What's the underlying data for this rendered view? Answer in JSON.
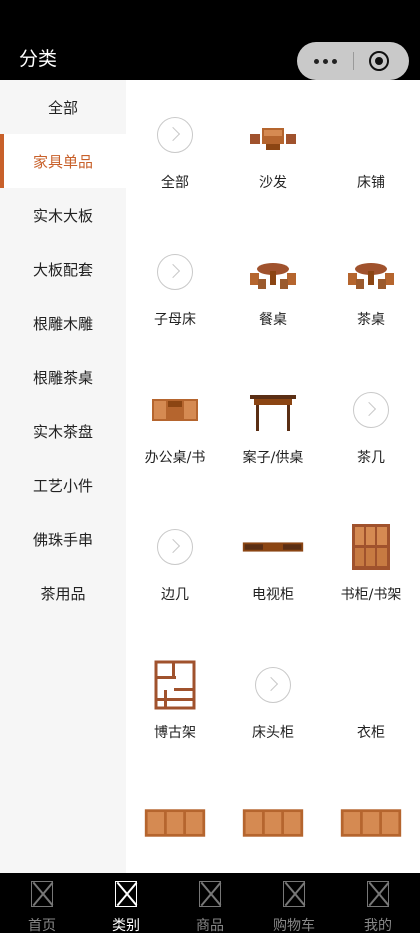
{
  "header": {
    "title": "分类"
  },
  "capsule": {
    "menu_icon": "more-dots-icon",
    "close_icon": "target-circle-icon"
  },
  "sidebar": {
    "items": [
      {
        "label": "全部"
      },
      {
        "label": "家具单品",
        "active": true
      },
      {
        "label": "实木大板"
      },
      {
        "label": "大板配套"
      },
      {
        "label": "根雕木雕"
      },
      {
        "label": "根雕茶桌"
      },
      {
        "label": "实木茶盘"
      },
      {
        "label": "工艺小件"
      },
      {
        "label": "佛珠手串"
      },
      {
        "label": "茶用品"
      }
    ],
    "accent_color": "#c8602a"
  },
  "grid": {
    "items": [
      {
        "label": "全部",
        "icon": "chevron-right-circle-icon"
      },
      {
        "label": "沙发",
        "icon": "sofa-image"
      },
      {
        "label": "床铺",
        "icon": "none"
      },
      {
        "label": "子母床",
        "icon": "chevron-right-circle-icon"
      },
      {
        "label": "餐桌",
        "icon": "dining-table-image"
      },
      {
        "label": "茶桌",
        "icon": "tea-table-image"
      },
      {
        "label": "办公桌/书",
        "icon": "office-desk-image"
      },
      {
        "label": "案子/供桌",
        "icon": "altar-table-image"
      },
      {
        "label": "茶几",
        "icon": "chevron-right-circle-icon"
      },
      {
        "label": "边几",
        "icon": "chevron-right-circle-icon"
      },
      {
        "label": "电视柜",
        "icon": "tv-cabinet-image"
      },
      {
        "label": "书柜/书架",
        "icon": "bookcase-image"
      },
      {
        "label": "博古架",
        "icon": "curio-shelf-image"
      },
      {
        "label": "床头柜",
        "icon": "chevron-right-circle-icon"
      },
      {
        "label": "衣柜",
        "icon": "none"
      },
      {
        "label": "",
        "icon": "cabinet-image"
      },
      {
        "label": "",
        "icon": "cabinet-image"
      },
      {
        "label": "",
        "icon": "cabinet-image"
      }
    ]
  },
  "tabbar": {
    "tabs": [
      {
        "label": "首页"
      },
      {
        "label": "类别",
        "active": true
      },
      {
        "label": "商品"
      },
      {
        "label": "购物车"
      },
      {
        "label": "我的"
      }
    ]
  }
}
